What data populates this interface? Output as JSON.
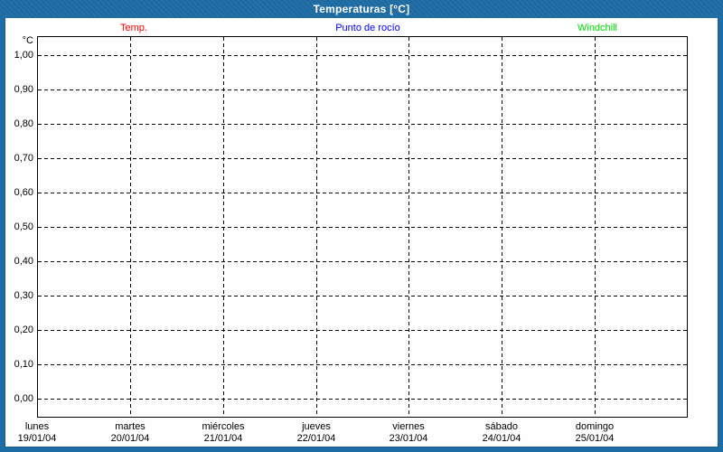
{
  "window": {
    "title": "Temperaturas [°C]",
    "colors": {
      "titlebar_bg": "#1e6ca3",
      "frame_border": "#1e6ca3",
      "frame_inner_line": "#1a5a8c",
      "content_bg": "#fdfefd",
      "grid_line": "#000000",
      "title_text": "#ffffff"
    }
  },
  "legend": {
    "items": [
      {
        "label": "Temp.",
        "color": "#ff0000"
      },
      {
        "label": "Punto de rocío",
        "color": "#0000ff"
      },
      {
        "label": "Windchill",
        "color": "#00e000"
      }
    ]
  },
  "chart_data": {
    "type": "line",
    "title": "Temperaturas [°C]",
    "ylabel": "°C",
    "y_axis": {
      "unit_label": "°C",
      "min": 0.0,
      "max": 1.0,
      "step": 0.1,
      "tick_labels": [
        "1,00",
        "0,90",
        "0,80",
        "0,70",
        "0,60",
        "0,50",
        "0,40",
        "0,30",
        "0,20",
        "0,10",
        "0,00"
      ]
    },
    "x_axis": {
      "categories": [
        {
          "day": "lunes",
          "date": "19/01/04"
        },
        {
          "day": "martes",
          "date": "20/01/04"
        },
        {
          "day": "miércoles",
          "date": "21/01/04"
        },
        {
          "day": "jueves",
          "date": "22/01/04"
        },
        {
          "day": "viernes",
          "date": "23/01/04"
        },
        {
          "day": "sábado",
          "date": "24/01/04"
        },
        {
          "day": "domingo",
          "date": "25/01/04"
        }
      ]
    },
    "series": [
      {
        "name": "Temp.",
        "color": "#ff0000",
        "values": []
      },
      {
        "name": "Punto de rocío",
        "color": "#0000ff",
        "values": []
      },
      {
        "name": "Windchill",
        "color": "#00e000",
        "values": []
      }
    ],
    "grid": "dashed",
    "legend_position": "top"
  }
}
